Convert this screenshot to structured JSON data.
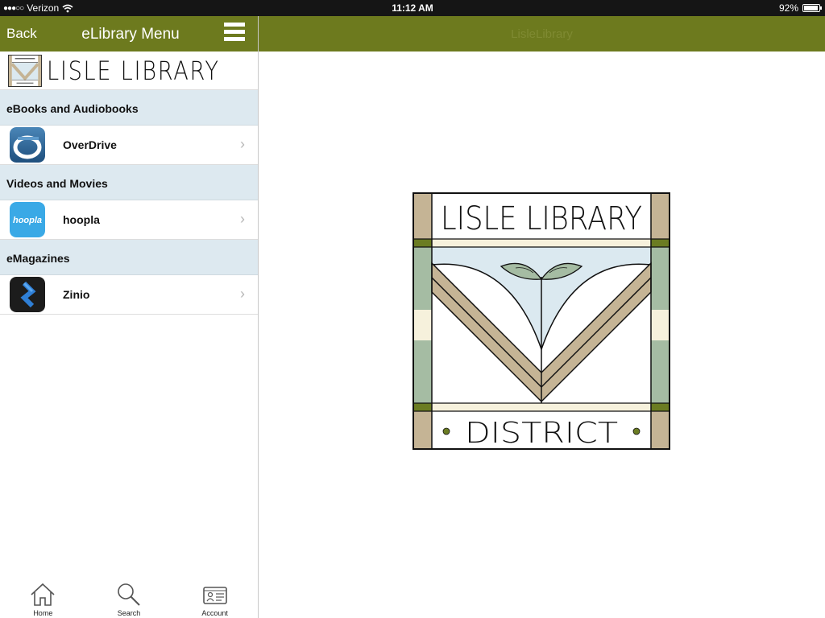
{
  "status_bar": {
    "signal": "●●●○○",
    "carrier": "Verizon",
    "time": "11:12 AM",
    "battery_text": "92%",
    "battery_level": 0.92
  },
  "sidebar": {
    "back_label": "Back",
    "title": "eLibrary Menu",
    "logo_text": "LISLE LIBRARY",
    "sections": [
      {
        "header": "eBooks and Audiobooks",
        "item": {
          "label": "OverDrive",
          "icon": "overdrive-icon"
        }
      },
      {
        "header": "Videos and Movies",
        "item": {
          "label": "hoopla",
          "icon": "hoopla-icon",
          "icon_text": "hoopla"
        }
      },
      {
        "header": "eMagazines",
        "item": {
          "label": "Zinio",
          "icon": "zinio-icon"
        }
      }
    ]
  },
  "tabs": [
    {
      "label": "Home",
      "icon": "home-icon"
    },
    {
      "label": "Search",
      "icon": "search-icon"
    },
    {
      "label": "Account",
      "icon": "account-card-icon"
    }
  ],
  "main": {
    "title": "LisleLibrary",
    "logo_top_text": "LISLE LIBRARY",
    "logo_bottom_text": "DISTRICT"
  },
  "colors": {
    "header_green": "#6d7a1e",
    "section_blue": "#dde9f0",
    "logo_tan": "#c5b495",
    "logo_sage": "#a5bca3",
    "logo_sky": "#dbe9f0",
    "logo_olive": "#6b7c22"
  }
}
